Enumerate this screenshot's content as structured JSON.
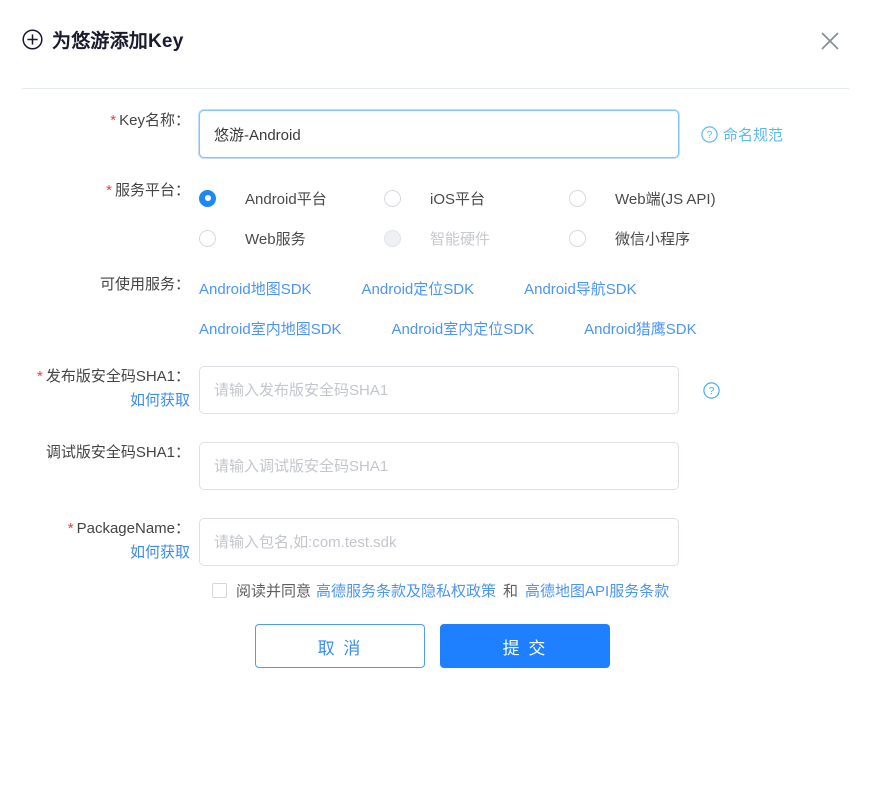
{
  "header": {
    "title": "为悠游添加Key",
    "plus_icon": "plus-circle-icon",
    "close_icon": "close-icon"
  },
  "form": {
    "key_name": {
      "label": "Key名称：",
      "required": true,
      "value": "悠游-Android",
      "placeholder": "",
      "hint_link": "命名规范",
      "hint_icon": "question-circle-icon"
    },
    "platform": {
      "label": "服务平台：",
      "required": true,
      "options": [
        {
          "label": "Android平台",
          "selected": true,
          "disabled": false
        },
        {
          "label": "iOS平台",
          "selected": false,
          "disabled": false
        },
        {
          "label": "Web端(JS API)",
          "selected": false,
          "disabled": false
        },
        {
          "label": "Web服务",
          "selected": false,
          "disabled": false
        },
        {
          "label": "智能硬件",
          "selected": false,
          "disabled": true
        },
        {
          "label": "微信小程序",
          "selected": false,
          "disabled": false
        }
      ]
    },
    "services": {
      "label": "可使用服务：",
      "links": [
        "Android地图SDK",
        "Android定位SDK",
        "Android导航SDK",
        "Android室内地图SDK",
        "Android室内定位SDK",
        "Android猎鹰SDK"
      ]
    },
    "release_sha1": {
      "label": "发布版安全码SHA1：",
      "required": true,
      "sub_link": "如何获取",
      "value": "",
      "placeholder": "请输入发布版安全码SHA1",
      "help_icon": "question-circle-icon"
    },
    "debug_sha1": {
      "label": "调试版安全码SHA1：",
      "required": false,
      "value": "",
      "placeholder": "请输入调试版安全码SHA1"
    },
    "package_name": {
      "label": "PackageName：",
      "required": true,
      "sub_link": "如何获取",
      "value": "",
      "placeholder": "请输入包名,如:com.test.sdk"
    },
    "agreement": {
      "checked": false,
      "prefix": "阅读并同意",
      "link1": "高德服务条款及隐私权政策",
      "separator": "和",
      "link2": "高德地图API服务条款"
    },
    "buttons": {
      "cancel": "取 消",
      "submit": "提 交"
    }
  },
  "colors": {
    "primary": "#1e80ff",
    "link": "#4b94f8",
    "link_light": "#5ab9fb",
    "required_star": "#e8413c",
    "border": "#dcdfe6",
    "focus_border": "#84c4fa"
  }
}
